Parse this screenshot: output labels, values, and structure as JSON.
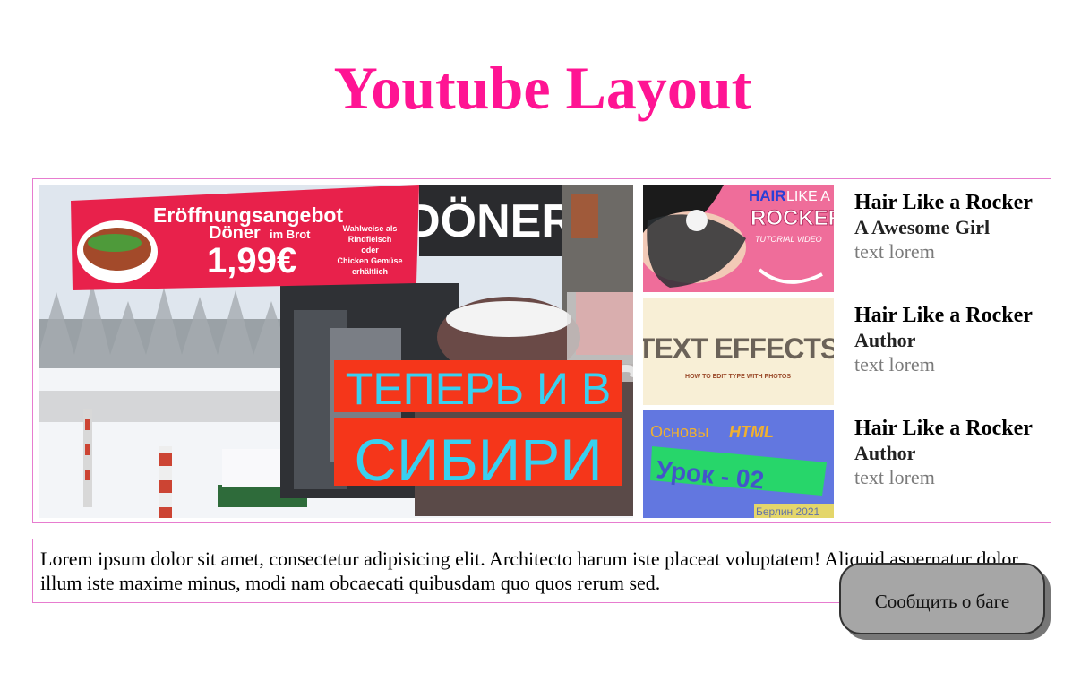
{
  "page": {
    "title": "Youtube Layout"
  },
  "main_video": {
    "thumbnail": {
      "banner_title": "Eröffnungsangebot",
      "banner_product": "Döner",
      "banner_product_suffix": "im Brot",
      "banner_price": "1,99€",
      "banner_note_1": "Wahlweise als",
      "banner_note_2": "Rindfleisch",
      "banner_note_3": "oder",
      "banner_note_4": "Chicken Gemüse",
      "banner_note_5": "erhältlich",
      "shop_sign": "DÖNER",
      "overlay_line_1": "ТЕПЕРЬ И В",
      "overlay_line_2": "СИБИРИ"
    }
  },
  "side_videos": [
    {
      "title": "Hair Like a Rocker",
      "author": "A Awesome Girl",
      "desc": "text lorem",
      "thumb": {
        "line_1a": "HAIR",
        "line_1b": "LIKE A",
        "line_2": "ROCKER",
        "line_3": "TUTORIAL VIDEO"
      }
    },
    {
      "title": "Hair Like a Rocker",
      "author": "Author",
      "desc": "text lorem",
      "thumb": {
        "line_1": "TEXT EFFECTS",
        "line_2": "HOW TO EDIT TYPE WITH PHOTOS"
      }
    },
    {
      "title": "Hair Like a Rocker",
      "author": "Author",
      "desc": "text lorem",
      "thumb": {
        "line_1a": "Основы",
        "line_1b": "HTML",
        "line_2": "Урок - 02",
        "line_3": "Берлин 2021"
      }
    }
  ],
  "description": {
    "text": "Lorem ipsum dolor sit amet, consectetur adipisicing elit. Architecto harum iste placeat voluptatem! Aliquid aspernatur dolor illum iste maxime minus, modi nam obcaecati quibusdam quo quos rerum sed."
  },
  "report_button": {
    "label": "Сообщить о баге"
  },
  "colors": {
    "title_pink": "#ff1493",
    "border_pink": "#e77ccf",
    "overlay_red": "#f5361a",
    "overlay_text": "#38d0f0",
    "banner_red": "#e8214b"
  }
}
